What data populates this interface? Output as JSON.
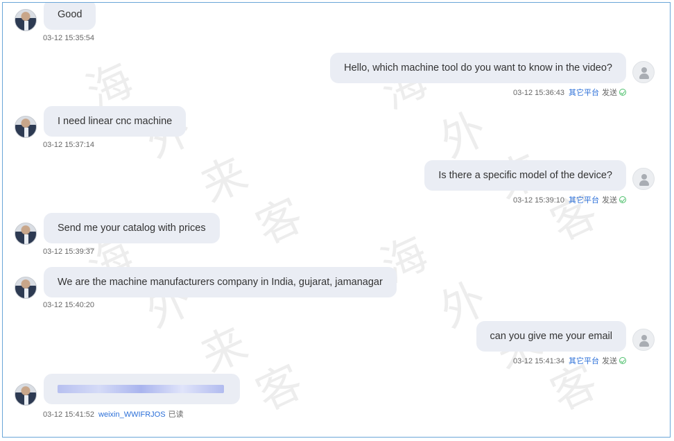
{
  "chat": {
    "messages": [
      {
        "side": "left",
        "text": "Good",
        "time": "03-12 15:35:54"
      },
      {
        "side": "right",
        "text": "Hello, which machine tool do you want to know in the video?",
        "time": "03-12 15:36:43",
        "platform": "其它平台",
        "status": "发送"
      },
      {
        "side": "left",
        "text": "I need linear cnc machine",
        "time": "03-12 15:37:14"
      },
      {
        "side": "right",
        "text": "Is there a specific model of the device?",
        "time": "03-12 15:39:10",
        "platform": "其它平台",
        "status": "发送"
      },
      {
        "side": "left",
        "text": "Send me your catalog with prices",
        "time": "03-12 15:39:37"
      },
      {
        "side": "left",
        "text": "We are the machine manufacturers company in India, gujarat, jamanagar",
        "time": "03-12 15:40:20"
      },
      {
        "side": "right",
        "text": "can you give me your email",
        "time": "03-12 15:41:34",
        "platform": "其它平台",
        "status": "发送"
      },
      {
        "side": "left",
        "text": "",
        "time": "03-12 15:41:52",
        "sender": "weixin_WWIFRJOS",
        "read_status": "已读",
        "email_blurred": true
      }
    ]
  },
  "watermark": {
    "chars": [
      "海",
      "外",
      "来",
      "客"
    ]
  },
  "colors": {
    "bubble": "#eaedf4",
    "link": "#2b6fd8",
    "sent_check": "#4cbf6b",
    "border": "#6aa6d8"
  }
}
